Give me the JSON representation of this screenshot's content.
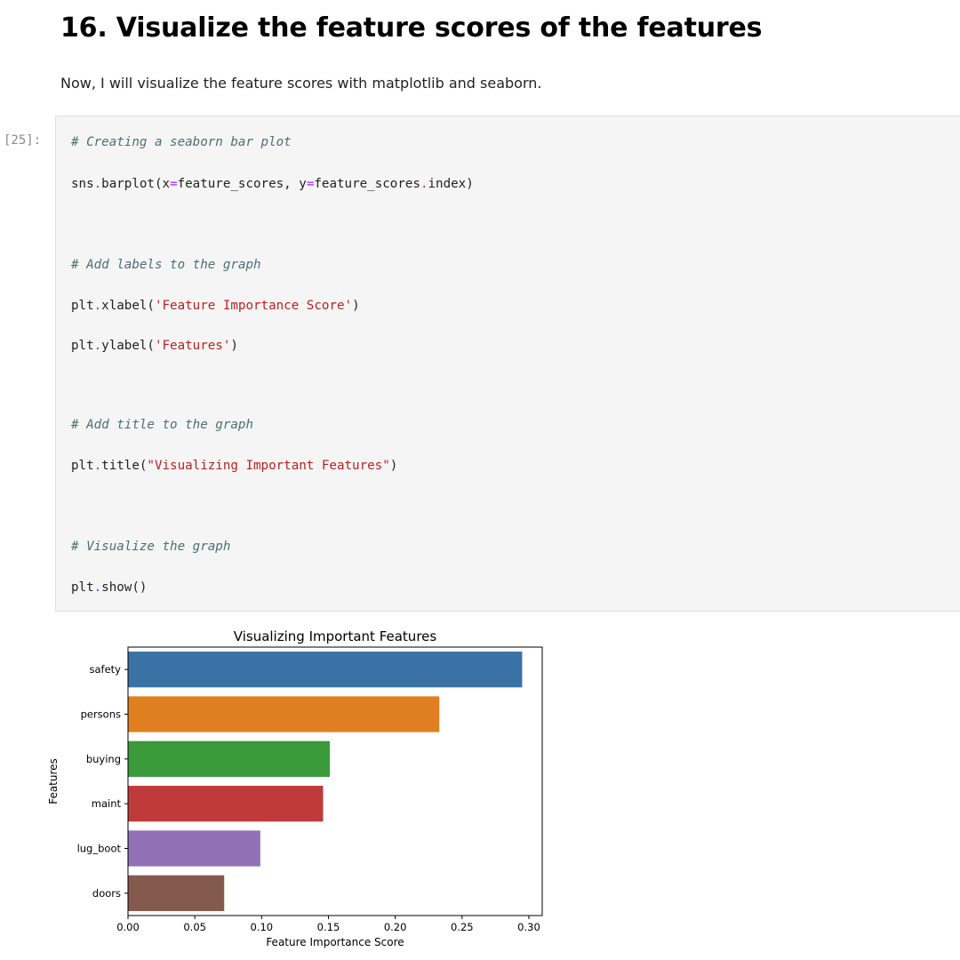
{
  "notebook": {
    "heading": "16. Visualize the feature scores of the features",
    "intro": "Now, I will visualize the feature scores with matplotlib and seaborn.",
    "cell": {
      "prompt": "[25]:",
      "lines": [
        {
          "tokens": [
            {
              "cls": "cm-comment",
              "text": "# Creating a seaborn bar plot"
            }
          ]
        },
        {
          "tokens": [
            {
              "cls": "cm-plain",
              "text": "sns"
            },
            {
              "cls": "cm-op",
              "text": "."
            },
            {
              "cls": "cm-plain",
              "text": "barplot(x"
            },
            {
              "cls": "cm-op",
              "text": "="
            },
            {
              "cls": "cm-plain",
              "text": "feature_scores, y"
            },
            {
              "cls": "cm-op",
              "text": "="
            },
            {
              "cls": "cm-plain",
              "text": "feature_scores"
            },
            {
              "cls": "cm-op",
              "text": "."
            },
            {
              "cls": "cm-plain",
              "text": "index)"
            }
          ]
        },
        {
          "tokens": [
            {
              "cls": "cm-comment",
              "text": "# Add labels to the graph"
            }
          ]
        },
        {
          "tokens": [
            {
              "cls": "cm-plain",
              "text": "plt"
            },
            {
              "cls": "cm-op",
              "text": "."
            },
            {
              "cls": "cm-plain",
              "text": "xlabel("
            },
            {
              "cls": "cm-string",
              "text": "'Feature Importance Score'"
            },
            {
              "cls": "cm-plain",
              "text": ")"
            }
          ]
        },
        {
          "tokens": [
            {
              "cls": "cm-plain",
              "text": "plt"
            },
            {
              "cls": "cm-op",
              "text": "."
            },
            {
              "cls": "cm-plain",
              "text": "ylabel("
            },
            {
              "cls": "cm-string",
              "text": "'Features'"
            },
            {
              "cls": "cm-plain",
              "text": ")"
            }
          ]
        },
        {
          "tokens": [
            {
              "cls": "cm-comment",
              "text": "# Add title to the graph"
            }
          ]
        },
        {
          "tokens": [
            {
              "cls": "cm-plain",
              "text": "plt"
            },
            {
              "cls": "cm-op",
              "text": "."
            },
            {
              "cls": "cm-plain",
              "text": "title("
            },
            {
              "cls": "cm-string",
              "text": "\"Visualizing Important Features\""
            },
            {
              "cls": "cm-plain",
              "text": ")"
            }
          ]
        },
        {
          "tokens": [
            {
              "cls": "cm-comment",
              "text": "# Visualize the graph"
            }
          ]
        },
        {
          "tokens": [
            {
              "cls": "cm-plain",
              "text": "plt"
            },
            {
              "cls": "cm-op",
              "text": "."
            },
            {
              "cls": "cm-plain",
              "text": "show()"
            }
          ]
        }
      ]
    }
  },
  "chart_data": {
    "type": "bar",
    "orientation": "horizontal",
    "title": "Visualizing Important Features",
    "xlabel": "Feature Importance Score",
    "ylabel": "Features",
    "categories": [
      "safety",
      "persons",
      "buying",
      "maint",
      "lug_boot",
      "doors"
    ],
    "values": [
      0.295,
      0.233,
      0.151,
      0.146,
      0.099,
      0.072
    ],
    "colors": [
      "#3a72a6",
      "#e07f20",
      "#3a9a3a",
      "#bf3a3a",
      "#9270b8",
      "#84594e"
    ],
    "xlim": [
      0,
      0.31
    ],
    "xticks": [
      0.0,
      0.05,
      0.1,
      0.15,
      0.2,
      0.25,
      0.3
    ],
    "xtick_labels": [
      "0.00",
      "0.05",
      "0.10",
      "0.15",
      "0.20",
      "0.25",
      "0.30"
    ],
    "grid": false,
    "legend": "none"
  }
}
